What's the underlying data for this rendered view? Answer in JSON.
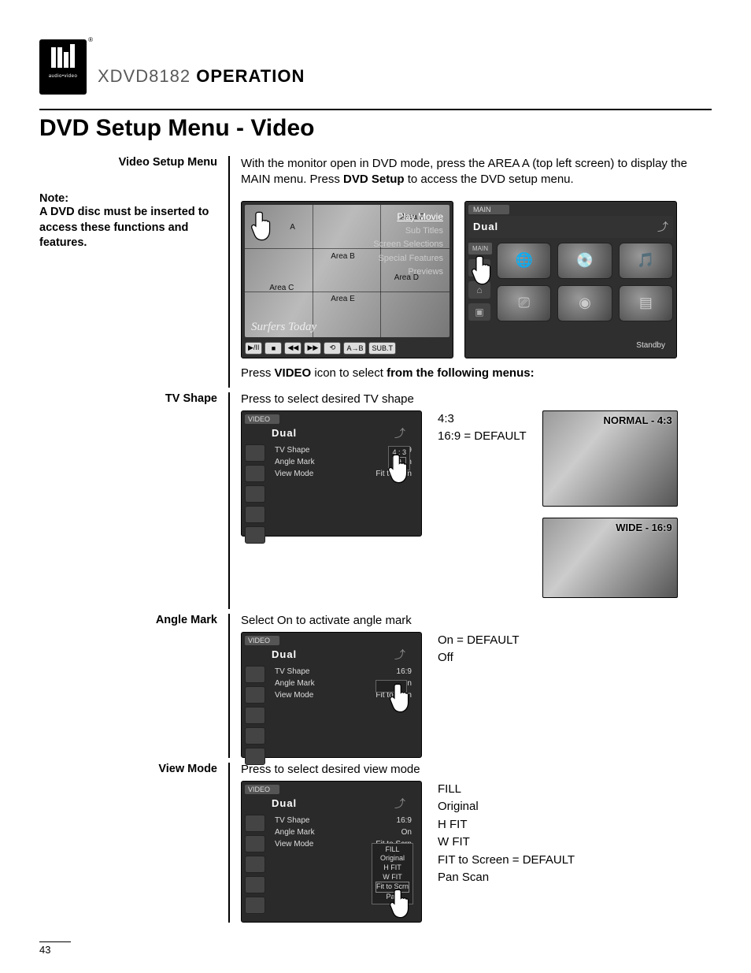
{
  "header": {
    "model": "XDVD8182",
    "operation": "OPERATION",
    "logo_sub": "audio•video"
  },
  "title": "DVD Setup Menu - Video",
  "labels": {
    "video_setup": "Video Setup Menu",
    "tv_shape": "TV Shape",
    "angle_mark": "Angle Mark",
    "view_mode": "View Mode"
  },
  "note": {
    "heading": "Note:",
    "body": "A DVD disc must be inserted to access these functions and features."
  },
  "intro": {
    "part1": "With the monitor open in DVD mode, press the AREA A (top left screen) to display the MAIN menu. Press ",
    "bold1": "DVD Setup",
    "part2": " to access the DVD setup menu."
  },
  "main_screen": {
    "areas": {
      "a": "A",
      "b": "Area B",
      "c": "Area C",
      "d": "Area D",
      "e": "Area E",
      "f": "Area F"
    },
    "dvd_menu": [
      "Play Movie",
      "Sub Titles",
      "Screen Selections",
      "Special Features",
      "Previews"
    ],
    "title_overlay": "Surfers Today",
    "buttons": [
      "▶/II",
      "■",
      "◀◀",
      "▶▶",
      "⟲",
      "A→B",
      "SUB.T"
    ]
  },
  "grid_screen": {
    "tab": "MAIN",
    "brand": "Dual",
    "side_tab": "MAIN",
    "standby": "Standby"
  },
  "sub_instr": {
    "pre": "Press ",
    "b1": "VIDEO",
    "mid": " icon to select ",
    "b2": "from the following menus:"
  },
  "video_common": {
    "tab": "VIDEO",
    "brand": "Dual",
    "rows": [
      {
        "k": "TV Shape",
        "v": "16:9"
      },
      {
        "k": "Angle Mark",
        "v": "On"
      },
      {
        "k": "View Mode",
        "v": "Fit to Scrn"
      }
    ]
  },
  "tv_shape": {
    "instr": "Press to select desired TV shape",
    "options": [
      "4:3",
      "16:9 = DEFAULT"
    ],
    "popup": [
      "4 : 3",
      "9"
    ],
    "preview1": "NORMAL - 4:3",
    "preview2": "WIDE - 16:9"
  },
  "angle_mark": {
    "instr": "Select On to activate angle mark",
    "options": [
      "On = DEFAULT",
      "Off"
    ]
  },
  "view_mode": {
    "instr": "Press to select desired view mode",
    "options": [
      "FILL",
      "Original",
      "H FIT",
      "W FIT",
      "FIT to Screen = DEFAULT",
      "Pan Scan"
    ],
    "popup": [
      "FILL",
      "Original",
      "H FIT",
      "W FIT",
      "Fit to Scrn",
      "Pan"
    ]
  },
  "page_number": "43"
}
